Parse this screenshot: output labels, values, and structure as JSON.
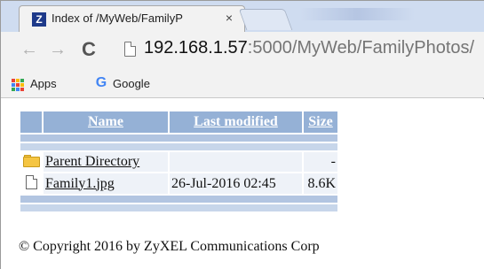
{
  "browser": {
    "tab": {
      "title": "Index of /MyWeb/FamilyP",
      "favicon": "Z",
      "close": "×"
    },
    "nav": {
      "back": "←",
      "forward": "→",
      "reload": "C"
    },
    "address": {
      "host": "192.168.1.57",
      "rest": ":5000/MyWeb/FamilyPhotos/"
    },
    "bookmarks": {
      "apps": "Apps",
      "google_glyph": "G",
      "google": "Google"
    },
    "colors": {
      "tabstrip": "#cfdcf0",
      "toolbar": "#f2f2f2",
      "apps_grid": [
        "#ea4335",
        "#fbbc05",
        "#34a853",
        "#4285f4",
        "#ea4335",
        "#fbbc05",
        "#34a853",
        "#4285f4",
        "#ea4335"
      ]
    }
  },
  "listing": {
    "headers": {
      "name": "Name",
      "modified": "Last modified",
      "size": "Size"
    },
    "rows": [
      {
        "icon": "folder-icon",
        "name": "Parent Directory",
        "modified": "",
        "size": "-"
      },
      {
        "icon": "file-icon",
        "name": "Family1.jpg",
        "modified": "26-Jul-2016 02:45",
        "size": "8.6K"
      }
    ],
    "colors": {
      "header": "#95b1d6",
      "separator": "#b2c5e1",
      "row": "#eef2f8"
    }
  },
  "footer": {
    "copyright": "© Copyright 2016 by ZyXEL Communications Corp"
  }
}
